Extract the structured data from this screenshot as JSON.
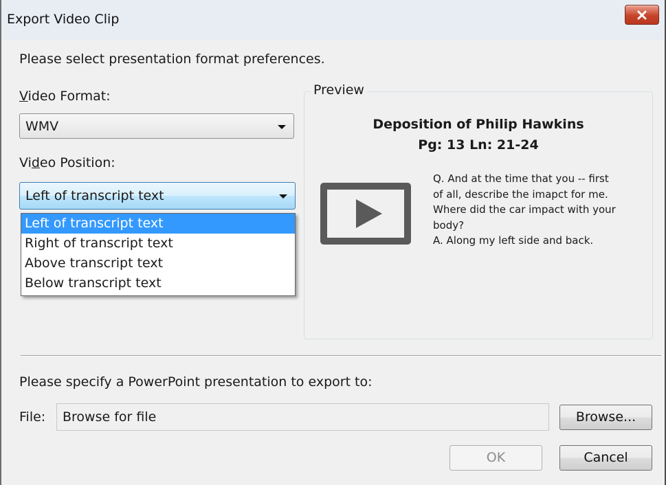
{
  "window": {
    "title": "Export Video Clip"
  },
  "instructions": "Please select presentation format preferences.",
  "video_format": {
    "label": "Video Format:",
    "mnemonic": "V",
    "label_rest": "ideo Format:",
    "value": "WMV"
  },
  "video_position": {
    "label_pre": "Vi",
    "mnemonic": "d",
    "label_rest": "eo Position:",
    "value": "Left of transcript text",
    "options": [
      "Left of transcript text",
      "Right of transcript text",
      "Above transcript text",
      "Below transcript text"
    ],
    "selected_index": 0
  },
  "preview": {
    "legend": "Preview",
    "title_line1": "Deposition of Philip Hawkins",
    "title_line2": "Pg: 13 Ln: 21-24",
    "transcript_lines": [
      "Q.  And at the time that you -- first",
      "of all, describe the imapct for me.",
      "Where did the car impact with your",
      "body?",
      "A.  Along my left side and back."
    ],
    "icon": "play-icon"
  },
  "export": {
    "prompt": "Please specify a PowerPoint presentation to export to:",
    "file_label": "File:",
    "file_placeholder": "Browse for file",
    "browse_label": "Browse...",
    "ok_label": "OK",
    "cancel_label": "Cancel"
  },
  "colors": {
    "selection": "#3399ff",
    "close_button": "#c7442a",
    "dialog_bg": "#f0f0f0"
  }
}
